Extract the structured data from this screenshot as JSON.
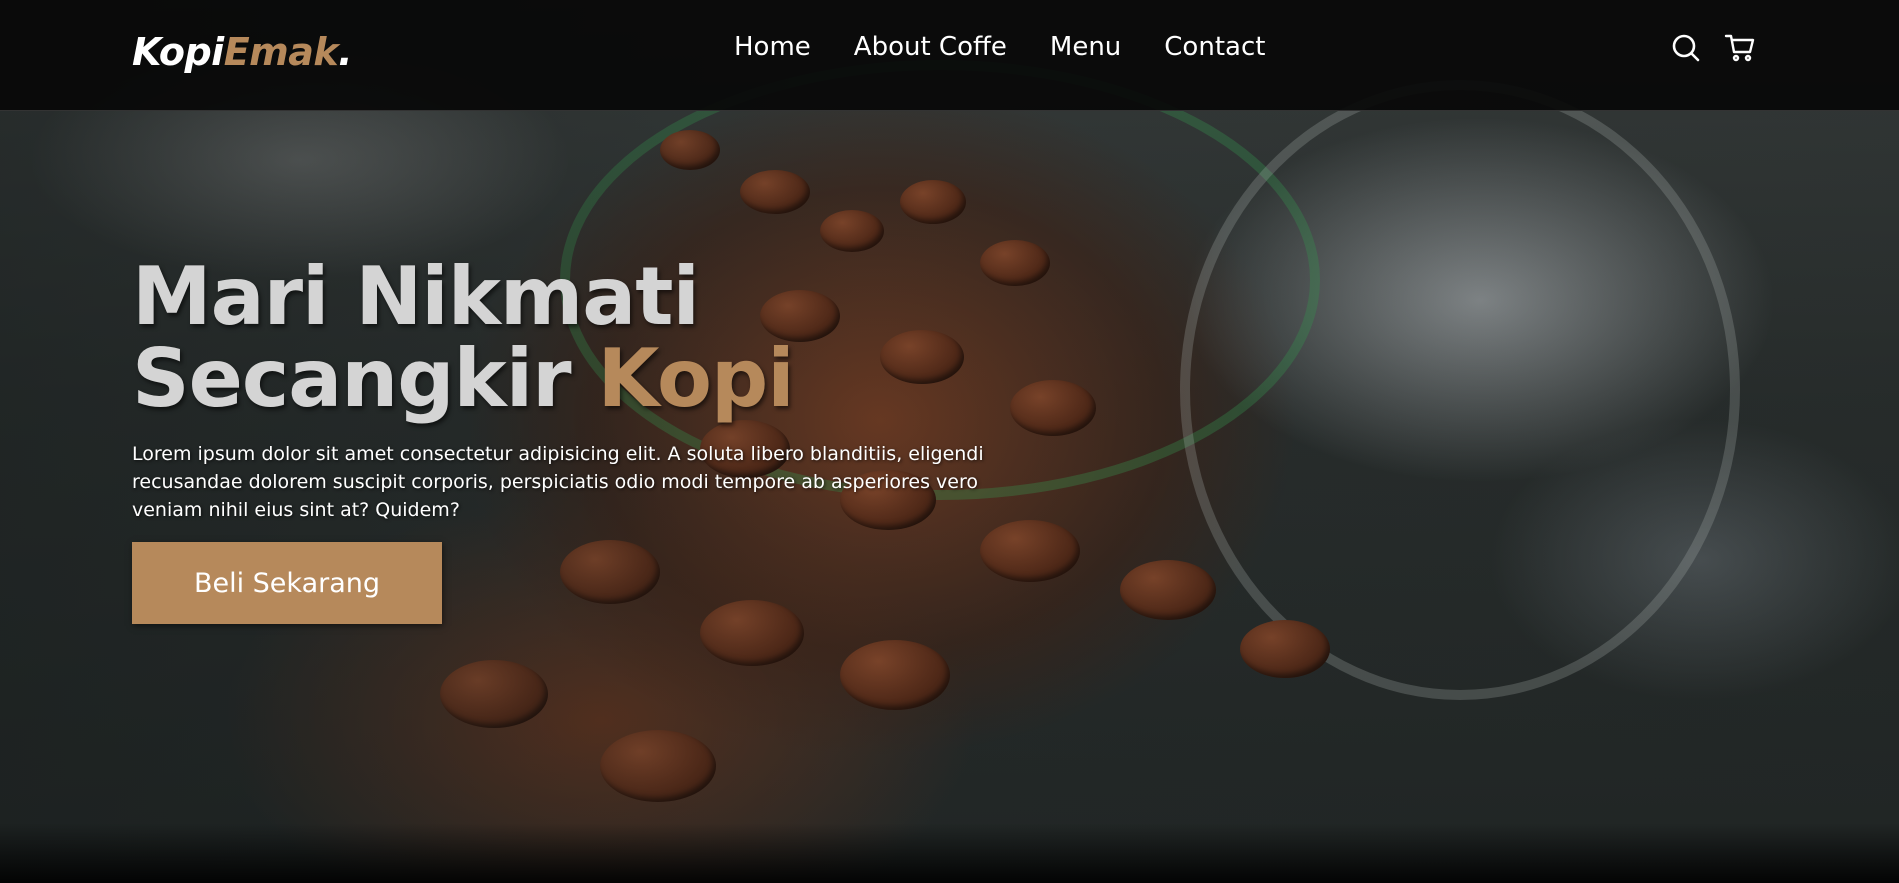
{
  "logo": {
    "part1": "Kopi",
    "part2": "Emak",
    "part3": "."
  },
  "nav": {
    "links": [
      "Home",
      "About Coffe",
      "Menu",
      "Contact"
    ],
    "icons": [
      "search-icon",
      "cart-icon"
    ]
  },
  "hero": {
    "title_line1": "Mari Nikmati",
    "title_line2_plain": "Secangkir ",
    "title_line2_accent": "Kopi",
    "description": "Lorem ipsum dolor sit amet consectetur adipisicing elit. A soluta libero blanditiis, eligendi recusandae dolorem suscipit corporis, perspiciatis odio modi tempore ab asperiores vero veniam nihil eius sint at? Quidem?",
    "cta_label": "Beli Sekarang"
  },
  "colors": {
    "accent": "#b6895b",
    "navbar_bg": "#080808",
    "title_text": "#d4d4d4"
  }
}
